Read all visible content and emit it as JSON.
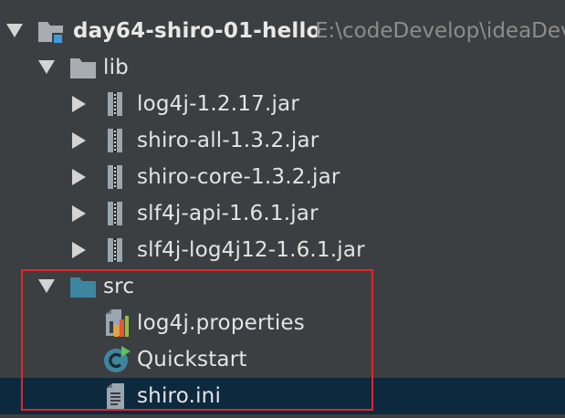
{
  "tree": {
    "project": {
      "name": "day64-shiro-01-hello",
      "path": "E:\\codeDevelop\\ideaDev",
      "icon": "module-folder-icon",
      "expanded": true
    },
    "lib": {
      "name": "lib",
      "icon": "folder-icon",
      "expanded": true,
      "items": [
        {
          "name": "log4j-1.2.17.jar",
          "icon": "jar-icon"
        },
        {
          "name": "shiro-all-1.3.2.jar",
          "icon": "jar-icon"
        },
        {
          "name": "shiro-core-1.3.2.jar",
          "icon": "jar-icon"
        },
        {
          "name": "slf4j-api-1.6.1.jar",
          "icon": "jar-icon"
        },
        {
          "name": "slf4j-log4j12-1.6.1.jar",
          "icon": "jar-icon"
        }
      ]
    },
    "src": {
      "name": "src",
      "icon": "source-folder-icon",
      "expanded": true,
      "items": [
        {
          "name": "log4j.properties",
          "icon": "properties-file-icon"
        },
        {
          "name": "Quickstart",
          "icon": "java-class-icon"
        },
        {
          "name": "shiro.ini",
          "icon": "text-file-icon",
          "selected": true
        }
      ]
    }
  },
  "colors": {
    "background": "#3c3f41",
    "selection": "#0d293e",
    "highlight_border": "#e0262d",
    "folder": "#a8adb3",
    "source_folder": "#3e86a0"
  }
}
